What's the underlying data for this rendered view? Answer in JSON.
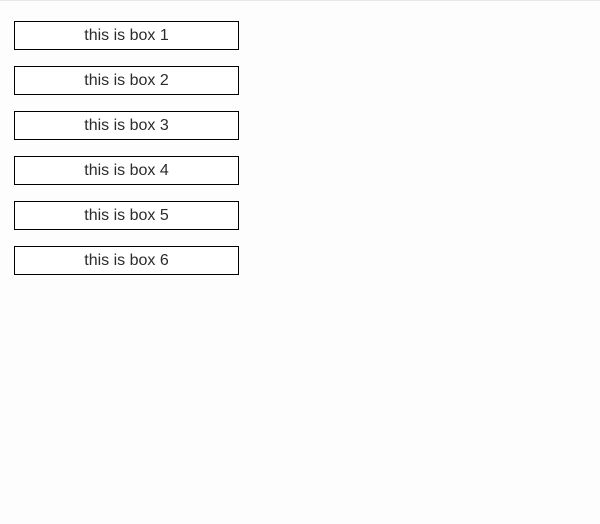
{
  "boxes": [
    {
      "label": "this is box 1"
    },
    {
      "label": "this is box 2"
    },
    {
      "label": "this is box 3"
    },
    {
      "label": "this is box 4"
    },
    {
      "label": "this is box 5"
    },
    {
      "label": "this is box 6"
    }
  ]
}
